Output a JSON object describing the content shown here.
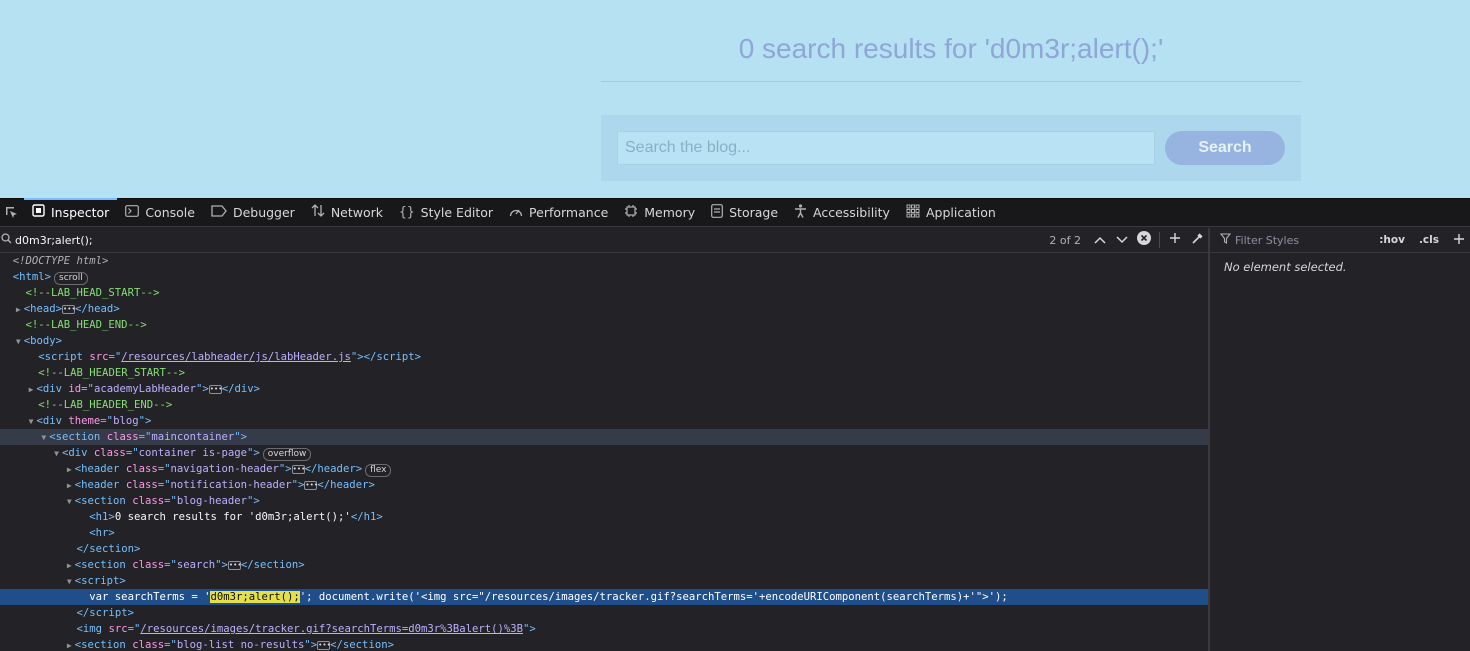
{
  "page": {
    "heading": "0 search results for 'd0m3r;alert();'",
    "search_placeholder": "Search the blog...",
    "search_button": "Search"
  },
  "devtools": {
    "tabs": [
      {
        "label": "Inspector",
        "icon": "inspector-icon"
      },
      {
        "label": "Console",
        "icon": "console-icon"
      },
      {
        "label": "Debugger",
        "icon": "debugger-icon"
      },
      {
        "label": "Network",
        "icon": "network-icon"
      },
      {
        "label": "Style Editor",
        "icon": "style-editor-icon"
      },
      {
        "label": "Performance",
        "icon": "performance-icon"
      },
      {
        "label": "Memory",
        "icon": "memory-icon"
      },
      {
        "label": "Storage",
        "icon": "storage-icon"
      },
      {
        "label": "Accessibility",
        "icon": "accessibility-icon"
      },
      {
        "label": "Application",
        "icon": "application-icon"
      }
    ],
    "active_tab": "Inspector",
    "search": {
      "query": "d0m3r;alert();",
      "match_count": "2 of 2"
    },
    "sidebar": {
      "filter_placeholder": "Filter Styles",
      "hov": ":hov",
      "cls": ".cls",
      "empty_message": "No element selected."
    },
    "tree": {
      "doctype": "<!DOCTYPE html>",
      "badge_scroll": "scroll",
      "badge_overflow": "overflow",
      "badge_flex": "flex",
      "comments": {
        "head_start": "<!--LAB_HEAD_START-->",
        "head_end": "<!--LAB_HEAD_END-->",
        "header_start": "<!--LAB_HEADER_START-->",
        "header_end": "<!--LAB_HEADER_END-->"
      },
      "script_src": "/resources/labheader/js/labHeader.js",
      "lab_header_id": "academyLabHeader",
      "div_theme": "blog",
      "section_maincontainer": "maincontainer",
      "div_container": "container is-page",
      "header_nav": "navigation-header",
      "header_notif": "notification-header",
      "section_blog_header": "blog-header",
      "h1_text": "0 search results for 'd0m3r;alert();'",
      "section_search": "search",
      "script_prefix": "var searchTerms = '",
      "script_highlight": "d0m3r;alert();",
      "script_suffix": "'; document.write('<img src=\"/resources/images/tracker.gif?searchTerms='+encodeURIComponent(searchTerms)+'\">');",
      "img_src": "/resources/images/tracker.gif?searchTerms=d0m3r%3Balert()%3B",
      "section_blog_list": "blog-list no-results"
    }
  }
}
